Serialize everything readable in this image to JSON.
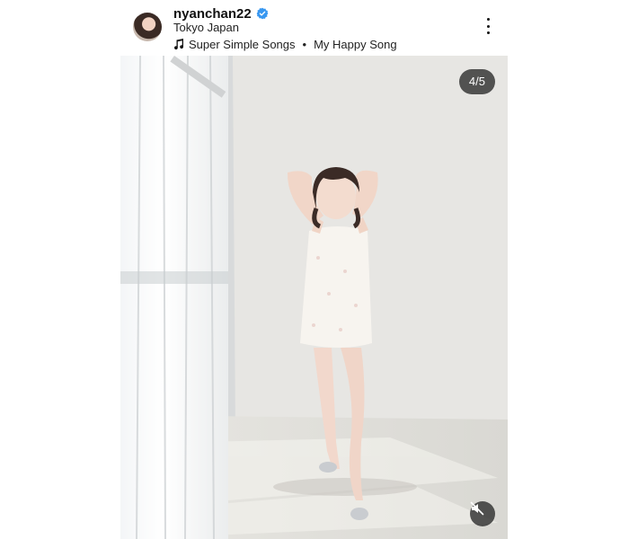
{
  "post": {
    "username": "nyanchan22",
    "verified": true,
    "location": "Tokyo Japan",
    "music": {
      "artist": "Super Simple Songs",
      "separator": "•",
      "title": "My Happy Song"
    },
    "carousel": {
      "counter": "4/5",
      "current": 4,
      "total": 5
    }
  },
  "icons": {
    "verified": "verified-badge-icon",
    "music": "music-note-icon",
    "more": "more-options-icon",
    "mute": "sound-off-icon"
  },
  "colors": {
    "verified": "#3897f0",
    "overlay": "#282828"
  }
}
